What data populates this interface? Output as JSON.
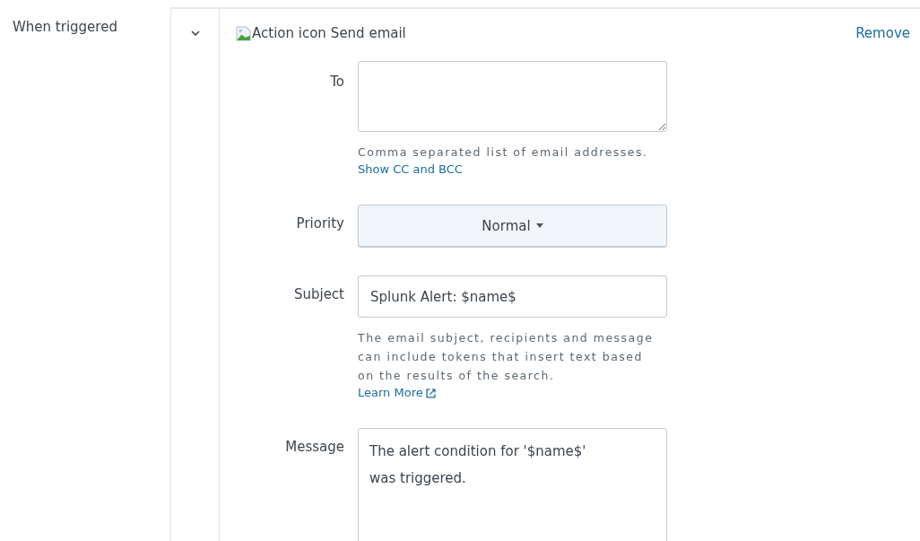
{
  "section_label": "When triggered",
  "action": {
    "expanded": true,
    "icon_alt": "Action icon",
    "title": "Send email",
    "remove_link": "Remove"
  },
  "fields": [
    {
      "kind": "textarea",
      "label": "To",
      "help": "Comma separated list of email addresses.",
      "link": "Show CC and BCC",
      "link_external": false
    },
    {
      "kind": "select",
      "label": "Priority",
      "value": "Normal"
    },
    {
      "kind": "input",
      "label": "Subject",
      "value": "Splunk Alert: $name$",
      "help": "The email subject, recipients and message can include tokens that insert text based on the results of the search.",
      "link": "Learn More",
      "link_external": true
    },
    {
      "kind": "message",
      "label": "Message",
      "value": "The alert condition for '$name$' was triggered."
    }
  ]
}
